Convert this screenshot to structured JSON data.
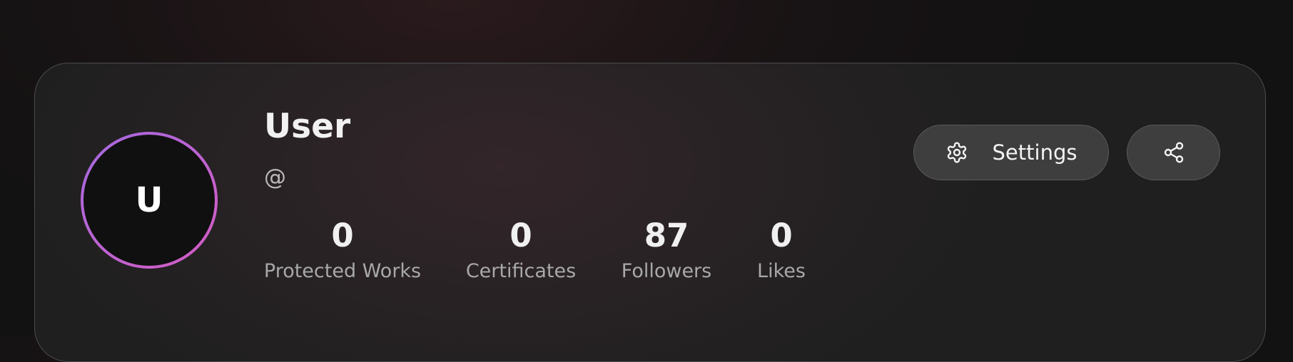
{
  "profile": {
    "avatar_initial": "U",
    "name": "User",
    "handle": "@"
  },
  "stats": [
    {
      "value": "0",
      "label": "Protected Works"
    },
    {
      "value": "0",
      "label": "Certificates"
    },
    {
      "value": "87",
      "label": "Followers"
    },
    {
      "value": "0",
      "label": "Likes"
    }
  ],
  "actions": {
    "settings_label": "Settings",
    "settings_icon": "gear-icon",
    "share_icon": "share-icon"
  },
  "colors": {
    "avatar_ring_start": "#a46ae0",
    "avatar_ring_end": "#d65cc3",
    "button_bg": "#3e3e3f"
  }
}
